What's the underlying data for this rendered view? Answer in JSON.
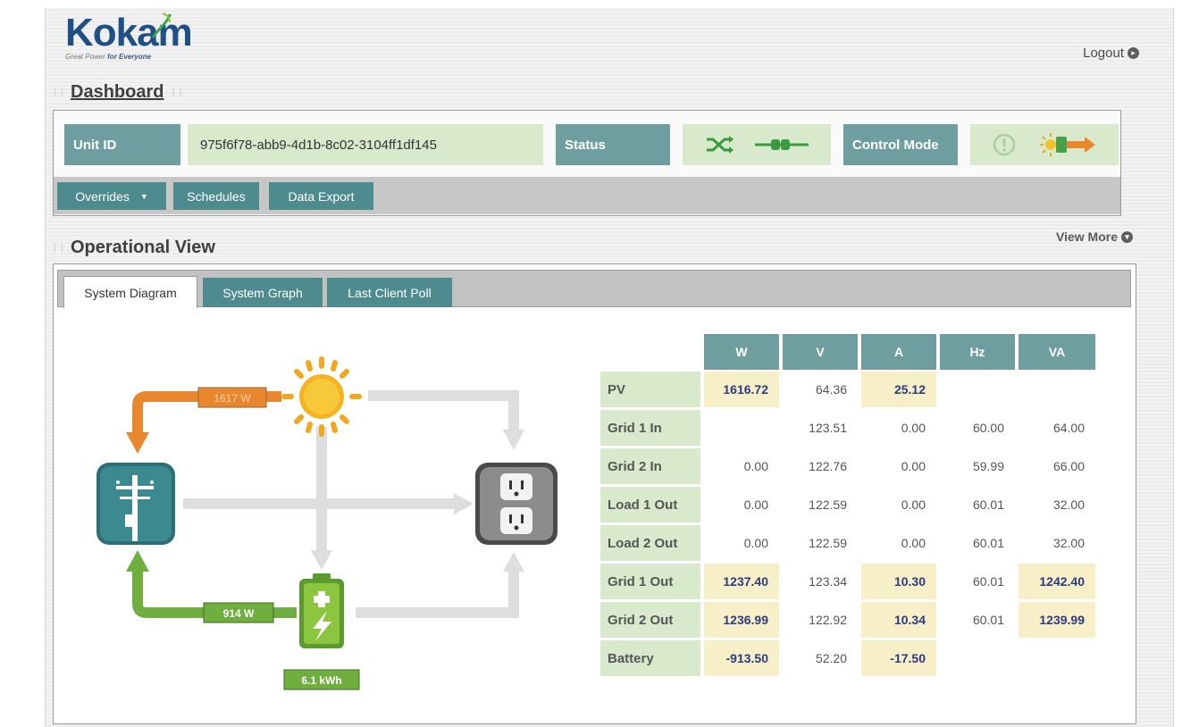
{
  "header": {
    "logo_text": "Kokam",
    "logo_tagline_pre": "Great Power ",
    "logo_tagline_bold": "for Everyone",
    "logout_label": "Logout",
    "dashboard_title": "Dashboard"
  },
  "unit": {
    "unit_id_label": "Unit ID",
    "unit_id_value": "975f6f78-abb9-4d1b-8c02-3104ff1df145",
    "status_label": "Status",
    "control_mode_label": "Control Mode"
  },
  "toolbar": {
    "overrides_label": "Overrides",
    "schedules_label": "Schedules",
    "data_export_label": "Data Export"
  },
  "operational": {
    "title": "Operational View",
    "view_more_label": "View More",
    "tabs": [
      "System Diagram",
      "System Graph",
      "Last Client Poll"
    ]
  },
  "diagram": {
    "pv_power": "1617 W",
    "grid_power": "914 W",
    "battery_energy": "6.1 kWh"
  },
  "table": {
    "columns": [
      "W",
      "V",
      "A",
      "Hz",
      "VA"
    ],
    "rows": [
      {
        "label": "PV",
        "cells": [
          "1616.72",
          "64.36",
          "25.12",
          "",
          ""
        ],
        "highlight": [
          true,
          false,
          true,
          false,
          false
        ]
      },
      {
        "label": "Grid 1 In",
        "cells": [
          "",
          "123.51",
          "0.00",
          "60.00",
          "64.00"
        ],
        "highlight": [
          false,
          false,
          false,
          false,
          false
        ]
      },
      {
        "label": "Grid 2 In",
        "cells": [
          "0.00",
          "122.76",
          "0.00",
          "59.99",
          "66.00"
        ],
        "highlight": [
          false,
          false,
          false,
          false,
          false
        ]
      },
      {
        "label": "Load 1 Out",
        "cells": [
          "0.00",
          "122.59",
          "0.00",
          "60.01",
          "32.00"
        ],
        "highlight": [
          false,
          false,
          false,
          false,
          false
        ]
      },
      {
        "label": "Load 2 Out",
        "cells": [
          "0.00",
          "122.59",
          "0.00",
          "60.01",
          "32.00"
        ],
        "highlight": [
          false,
          false,
          false,
          false,
          false
        ]
      },
      {
        "label": "Grid 1 Out",
        "cells": [
          "1237.40",
          "123.34",
          "10.30",
          "60.01",
          "1242.40"
        ],
        "highlight": [
          true,
          false,
          true,
          false,
          true
        ]
      },
      {
        "label": "Grid 2 Out",
        "cells": [
          "1236.99",
          "122.92",
          "10.34",
          "60.01",
          "1239.99"
        ],
        "highlight": [
          true,
          false,
          true,
          false,
          true
        ]
      },
      {
        "label": "Battery",
        "cells": [
          "-913.50",
          "52.20",
          "-17.50",
          "",
          ""
        ],
        "highlight": [
          true,
          false,
          true,
          false,
          false
        ]
      }
    ]
  },
  "colors": {
    "teal_header": "#6f9ea0",
    "button_teal": "#4e8b8e",
    "label_green": "#d8e9cc",
    "highlight_yellow": "#f7efc8",
    "pv_orange": "#e8872e",
    "grid_green": "#6fae3f"
  },
  "icons": {
    "status": [
      "shuffle-icon",
      "plug-icon"
    ],
    "control_mode": [
      "warning-circle-icon",
      "solar-charge-icon"
    ]
  }
}
